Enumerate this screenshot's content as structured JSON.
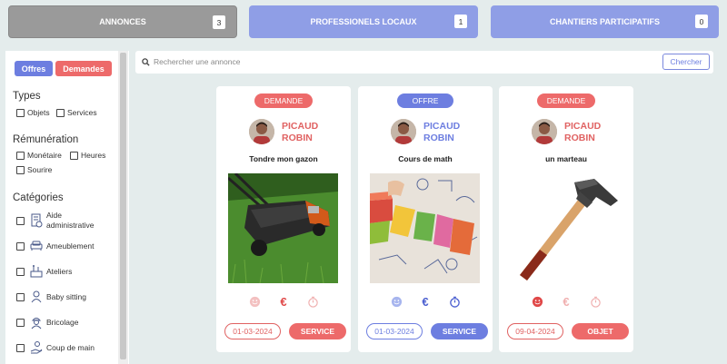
{
  "tabs": [
    {
      "label": "ANNONCES",
      "count": "3"
    },
    {
      "label": "PROFESSIONELS LOCAUX",
      "count": "1"
    },
    {
      "label": "CHANTIERS PARTICIPATIFS",
      "count": "0"
    }
  ],
  "sidebar": {
    "offres_label": "Offres",
    "demandes_label": "Demandes",
    "types_heading": "Types",
    "types": [
      "Objets",
      "Services"
    ],
    "remuneration_heading": "Rémunération",
    "remuneration": [
      "Monétaire",
      "Heures",
      "Sourire"
    ],
    "categories_heading": "Catégories",
    "categories": [
      {
        "label": "Aide administrative",
        "icon": "document-icon"
      },
      {
        "label": "Ameublement",
        "icon": "sofa-icon"
      },
      {
        "label": "Ateliers",
        "icon": "workshop-icon"
      },
      {
        "label": "Baby sitting",
        "icon": "baby-icon"
      },
      {
        "label": "Bricolage",
        "icon": "worker-icon"
      },
      {
        "label": "Coup de main",
        "icon": "helping-hand-icon"
      }
    ]
  },
  "search": {
    "placeholder": "Rechercher une annonce",
    "button_label": "Chercher"
  },
  "cards": [
    {
      "badge": "DEMANDE",
      "user_first": "PICAUD",
      "user_last": "ROBIN",
      "title": "Tondre mon gazon",
      "date": "01-03-2024",
      "type": "SERVICE",
      "theme": "red",
      "active_icon": "euro-icon"
    },
    {
      "badge": "OFFRE",
      "user_first": "PICAUD",
      "user_last": "ROBIN",
      "title": "Cours de math",
      "date": "01-03-2024",
      "type": "SERVICE",
      "theme": "blue",
      "active_icon": "all"
    },
    {
      "badge": "DEMANDE",
      "user_first": "PICAUD",
      "user_last": "ROBIN",
      "title": "un marteau",
      "date": "09-04-2024",
      "type": "OBJET",
      "theme": "red",
      "active_icon": "smile-icon"
    }
  ],
  "colors": {
    "accent_blue": "#6d7ee0",
    "accent_red": "#ed6a6a",
    "tab_active": "#9a9a9a",
    "tab_inactive": "#8f9ee6",
    "background": "#e4ecec"
  }
}
